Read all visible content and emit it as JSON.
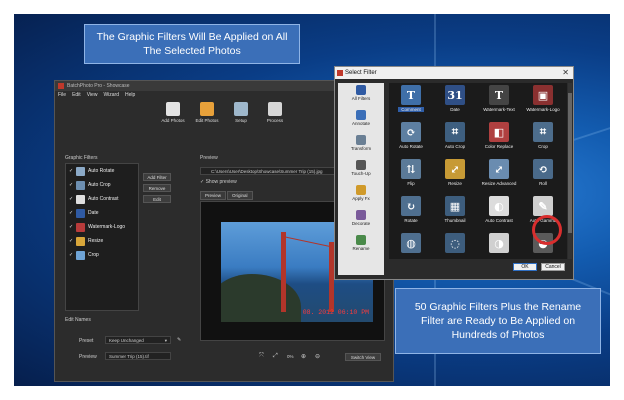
{
  "callouts": {
    "top": "The Graphic Filters Will Be Applied on All The Selected Photos",
    "bottom": "50 Graphic Filters Plus the Rename Filter are Ready to Be Applied on Hundreds of Photos"
  },
  "main_window": {
    "title": "BatchPhoto Pro - Showcase",
    "menu": [
      "File",
      "Edit",
      "View",
      "Wizard",
      "Help"
    ],
    "toolbar": [
      {
        "label": "Add Photos",
        "color": "#e3e3e3"
      },
      {
        "label": "Edit Photos",
        "color": "#e8a13a"
      },
      {
        "label": "Setup",
        "color": "#9fb8cc"
      },
      {
        "label": "Process",
        "color": "#d6d6d6"
      }
    ],
    "graphic_filters_label": "Graphic Filters",
    "preview_label": "Preview",
    "filters": [
      {
        "label": "Auto Rotate",
        "checked": "✓",
        "color": "#8ba9c7"
      },
      {
        "label": "Auto Crop",
        "checked": "✓",
        "color": "#6d8fb1"
      },
      {
        "label": "Auto Contrast",
        "checked": "✓",
        "color": "#dedede"
      },
      {
        "label": "Date",
        "checked": "✓",
        "color": "#2f5aa3"
      },
      {
        "label": "Watermark-Logo",
        "checked": "✓",
        "color": "#b83b3b"
      },
      {
        "label": "Resize",
        "checked": "✓",
        "color": "#d8a63a"
      },
      {
        "label": "Crop",
        "checked": "✓",
        "color": "#6fa4d6"
      }
    ],
    "side_buttons": [
      "Add Filter",
      "Remove",
      "Edit"
    ],
    "path": "C:\\Users\\User\\Desktop\\Showcase\\Summer Trip (15).jpg",
    "show_preview": "Show preview",
    "tabs": [
      "Preview",
      "Original"
    ],
    "stamp": "08. 2012 06:10 PM",
    "edit_names_label": "Edit Names",
    "preset_label": "Preset",
    "preset_value": "Keep Unchanged",
    "preview_name_label": "Preview",
    "preview_name_value": "Summer Trip (15).tif",
    "zoom_value": "0%",
    "switch_view": "Switch View"
  },
  "dialog": {
    "title": "Select Filter",
    "close": "✕",
    "categories": [
      {
        "label": "All Filters",
        "color": "#2f5aa3"
      },
      {
        "label": "Annotate",
        "color": "#3b6fb8"
      },
      {
        "label": "Transform",
        "color": "#6a7f94"
      },
      {
        "label": "Touch-Up",
        "color": "#555555"
      },
      {
        "label": "Apply Fx",
        "color": "#d09a2a"
      },
      {
        "label": "Decorate",
        "color": "#7a5a9a"
      },
      {
        "label": "Rename",
        "color": "#4a8a4a"
      }
    ],
    "filters": [
      {
        "label": "Comment",
        "glyph": "T",
        "color": "#3f6fa8",
        "selected": true
      },
      {
        "label": "Date",
        "glyph": "31",
        "color": "#2f4f86",
        "selected": false
      },
      {
        "label": "Watermark-Text",
        "glyph": "T",
        "color": "#444444",
        "selected": false
      },
      {
        "label": "Watermark-Logo",
        "glyph": "▣",
        "color": "#8a3030",
        "selected": false
      },
      {
        "label": "Auto Rotate",
        "glyph": "⟳",
        "color": "#5d7fa1",
        "selected": false
      },
      {
        "label": "Auto Crop",
        "glyph": "⌗",
        "color": "#3e5f80",
        "selected": false
      },
      {
        "label": "Color Replace",
        "glyph": "◧",
        "color": "#b04040",
        "selected": false
      },
      {
        "label": "Crop",
        "glyph": "⌗",
        "color": "#4d6d8c",
        "selected": false
      },
      {
        "label": "Flip",
        "glyph": "⇅",
        "color": "#5b7a98",
        "selected": false
      },
      {
        "label": "Resize",
        "glyph": "⤢",
        "color": "#c79a35",
        "selected": false
      },
      {
        "label": "Resize Advanced",
        "glyph": "⤢",
        "color": "#6a8cb0",
        "selected": false
      },
      {
        "label": "Roll",
        "glyph": "⟲",
        "color": "#4a6a8a",
        "selected": false
      },
      {
        "label": "Rotate",
        "glyph": "↻",
        "color": "#4f6f8f",
        "selected": false
      },
      {
        "label": "Thumbnail",
        "glyph": "▦",
        "color": "#3d5d7d",
        "selected": false
      },
      {
        "label": "Auto Contrast",
        "glyph": "◐",
        "color": "#dcdcdc",
        "selected": false
      },
      {
        "label": "Auto Gamma",
        "glyph": "✎",
        "color": "#cfcfcf",
        "selected": false
      },
      {
        "label": "",
        "glyph": "◍",
        "color": "#4f6f8f",
        "selected": false
      },
      {
        "label": "",
        "glyph": "◌",
        "color": "#3d5d7d",
        "selected": false
      },
      {
        "label": "",
        "glyph": "◑",
        "color": "#d0d0d0",
        "selected": false
      },
      {
        "label": "",
        "glyph": "◒",
        "color": "#5a5a5a",
        "selected": false
      }
    ],
    "ok": "OK",
    "cancel": "Cancel"
  }
}
